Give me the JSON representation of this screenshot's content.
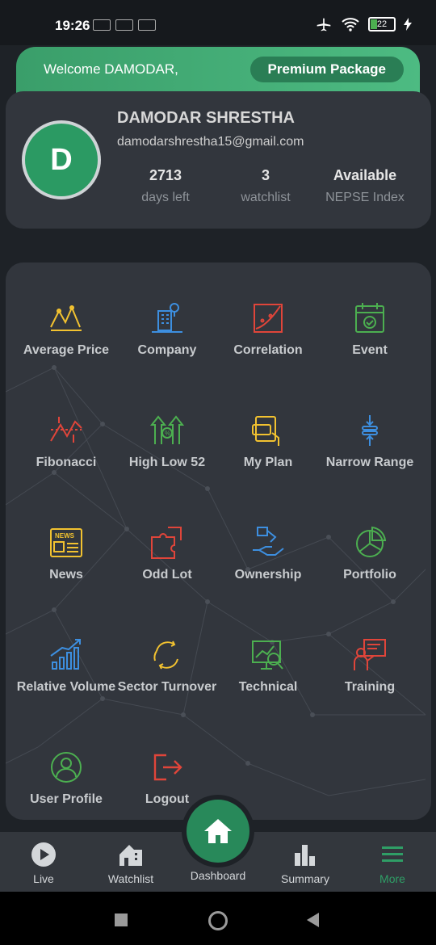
{
  "status": {
    "time": "19:26",
    "battery": "22"
  },
  "welcome": {
    "text": "Welcome DAMODAR,",
    "package": "Premium Package"
  },
  "profile": {
    "initial": "D",
    "name": "DAMODAR SHRESTHA",
    "email": "damodarshrestha15@gmail.com",
    "stats": [
      {
        "value": "2713",
        "label": "days left"
      },
      {
        "value": "3",
        "label": "watchlist"
      },
      {
        "value": "Available",
        "label": "NEPSE Index"
      }
    ]
  },
  "menu": [
    {
      "label": "Average Price",
      "icon": "average-price-icon",
      "color": "#f2c230"
    },
    {
      "label": "Company",
      "icon": "company-icon",
      "color": "#3d8fe0"
    },
    {
      "label": "Correlation",
      "icon": "correlation-icon",
      "color": "#e0453a"
    },
    {
      "label": "Event",
      "icon": "event-calendar-icon",
      "color": "#4caf50"
    },
    {
      "label": "Fibonacci",
      "icon": "fibonacci-icon",
      "color": "#e0453a"
    },
    {
      "label": "High Low 52",
      "icon": "high-low-icon",
      "color": "#4caf50"
    },
    {
      "label": "My Plan",
      "icon": "my-plan-icon",
      "color": "#f2c230"
    },
    {
      "label": "Narrow Range",
      "icon": "narrow-range-icon",
      "color": "#3d8fe0"
    },
    {
      "label": "News",
      "icon": "news-icon",
      "color": "#f2c230"
    },
    {
      "label": "Odd Lot",
      "icon": "odd-lot-puzzle-icon",
      "color": "#e0453a"
    },
    {
      "label": "Ownership",
      "icon": "ownership-icon",
      "color": "#3d8fe0"
    },
    {
      "label": "Portfolio",
      "icon": "portfolio-pie-icon",
      "color": "#4caf50"
    },
    {
      "label": "Relative Volume",
      "icon": "relative-volume-icon",
      "color": "#3d8fe0"
    },
    {
      "label": "Sector Turnover",
      "icon": "sector-turnover-icon",
      "color": "#f2c230"
    },
    {
      "label": "Technical",
      "icon": "technical-icon",
      "color": "#4caf50"
    },
    {
      "label": "Training",
      "icon": "training-icon",
      "color": "#e0453a"
    },
    {
      "label": "User Profile",
      "icon": "user-profile-icon",
      "color": "#4caf50"
    },
    {
      "label": "Logout",
      "icon": "logout-icon",
      "color": "#e0453a"
    }
  ],
  "nav": [
    {
      "label": "Live",
      "icon": "play-icon"
    },
    {
      "label": "Watchlist",
      "icon": "watchlist-icon"
    },
    {
      "label": "Dashboard",
      "icon": "home-icon"
    },
    {
      "label": "Summary",
      "icon": "summary-chart-icon"
    },
    {
      "label": "More",
      "icon": "menu-icon"
    }
  ]
}
